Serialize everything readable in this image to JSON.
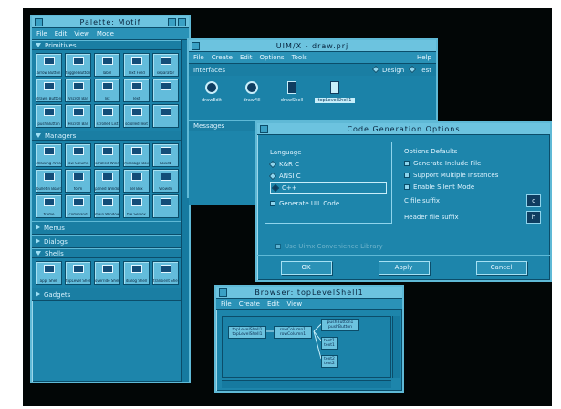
{
  "palette": {
    "title": "Palette: Motif",
    "menu": [
      "File",
      "Edit",
      "View",
      "Mode"
    ],
    "sections": {
      "primitives": "Primitives",
      "managers": "Managers",
      "menus": "Menus",
      "dialogs": "Dialogs",
      "shells": "Shells",
      "gadgets": "Gadgets"
    },
    "primitive_tiles": [
      "arrow Button",
      "toggle Button",
      "label",
      "Text Field",
      "separator",
      "drawn Button",
      "Vscroll Bar",
      "list",
      "Text",
      "",
      "push Button",
      "Hscroll Bar",
      "scrolled List",
      "scrolled Text",
      ""
    ],
    "manager_tiles": [
      "drawing Area",
      "row Column",
      "scrolled Window",
      "message Box",
      "Rowdb",
      "bulletin Board",
      "form",
      "paned Window",
      "sel Box",
      "Vrowdb",
      "frame",
      "command",
      "main Window",
      "file Selbox",
      ""
    ],
    "shell_tiles": [
      "appl Shell",
      "topLevel Shell",
      "override Shell",
      "dialog Shell",
      "transient Shell"
    ]
  },
  "main_window": {
    "title": "UIM/X - draw.prj",
    "menu": [
      "File",
      "Create",
      "Edit",
      "Options",
      "Tools"
    ],
    "help": "Help",
    "interfaces_label": "Interfaces",
    "design_label": "Design",
    "test_label": "Test",
    "interface_items": [
      "drawEdit",
      "drawFill",
      "drawShell",
      "topLevelShell1"
    ],
    "messages_label": "Messages"
  },
  "code_gen": {
    "title": "Code Generation Options",
    "language_label": "Language",
    "languages": [
      "K&R C",
      "ANSI C",
      "C++"
    ],
    "selected_language": "C++",
    "generate_uil": "Generate UIL Code",
    "use_uimx_lib": "Use Uimx Convenience Library",
    "defaults_label": "Options Defaults",
    "defaults": [
      "Generate Include File",
      "Support Multiple Instances",
      "Enable Silent Mode"
    ],
    "c_suffix_label": "C file suffix",
    "c_suffix_value": "c",
    "h_suffix_label": "Header file suffix",
    "h_suffix_value": "h",
    "ok": "OK",
    "apply": "Apply",
    "cancel": "Cancel"
  },
  "browser": {
    "title": "Browser: topLevelShell1",
    "menu": [
      "File",
      "Create",
      "Edit",
      "View"
    ],
    "nodes": {
      "root": "topLevelShell1 topLevelShell1",
      "row": "rowColumn1 rowColumn1",
      "push": "pushButton1 pushButton",
      "text1": "text1 text1",
      "text2": "text2 text2"
    }
  },
  "colors": {
    "background": "#020606",
    "window": "#1d85ab",
    "title": "#6cc3df"
  }
}
